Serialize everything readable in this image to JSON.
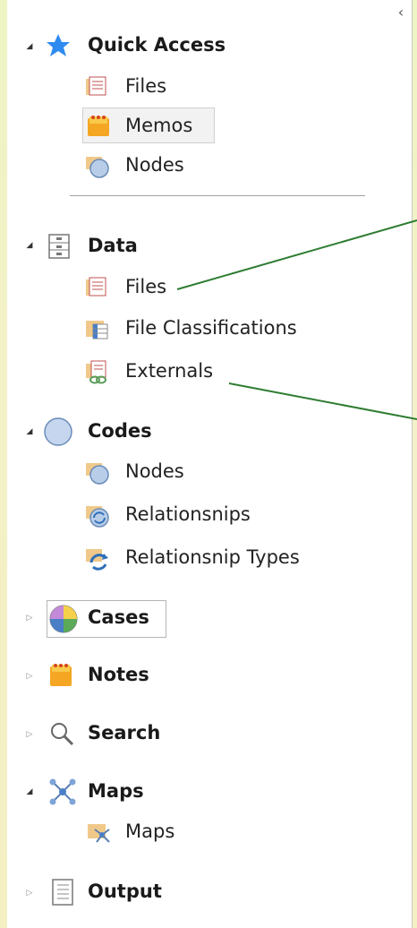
{
  "panel": {
    "collapse_glyph": "‹"
  },
  "quick_access": {
    "label": "Quick Access",
    "items": [
      {
        "label": "Files",
        "icon": "files-folder-icon"
      },
      {
        "label": "Memos",
        "icon": "memos-folder-icon"
      },
      {
        "label": "Nodes",
        "icon": "nodes-folder-icon"
      }
    ]
  },
  "data": {
    "label": "Data",
    "items": [
      {
        "label": "Files",
        "icon": "files-folder-icon"
      },
      {
        "label": "File Classifications",
        "icon": "file-classifications-icon"
      },
      {
        "label": "Externals",
        "icon": "externals-folder-icon"
      }
    ]
  },
  "codes": {
    "label": "Codes",
    "items": [
      {
        "label": "Nodes",
        "icon": "nodes-folder-icon"
      },
      {
        "label": "Relationsnips",
        "icon": "relationships-folder-icon"
      },
      {
        "label": "Relationsnip Types",
        "icon": "relationship-types-icon"
      }
    ]
  },
  "cases": {
    "label": "Cases"
  },
  "notes": {
    "label": "Notes"
  },
  "search": {
    "label": "Search"
  },
  "maps": {
    "label": "Maps",
    "items": [
      {
        "label": "Maps",
        "icon": "maps-folder-icon"
      }
    ]
  },
  "output": {
    "label": "Output"
  },
  "colors": {
    "accent_green": "#2e7d32",
    "selection_bg": "#f2f2f2"
  }
}
